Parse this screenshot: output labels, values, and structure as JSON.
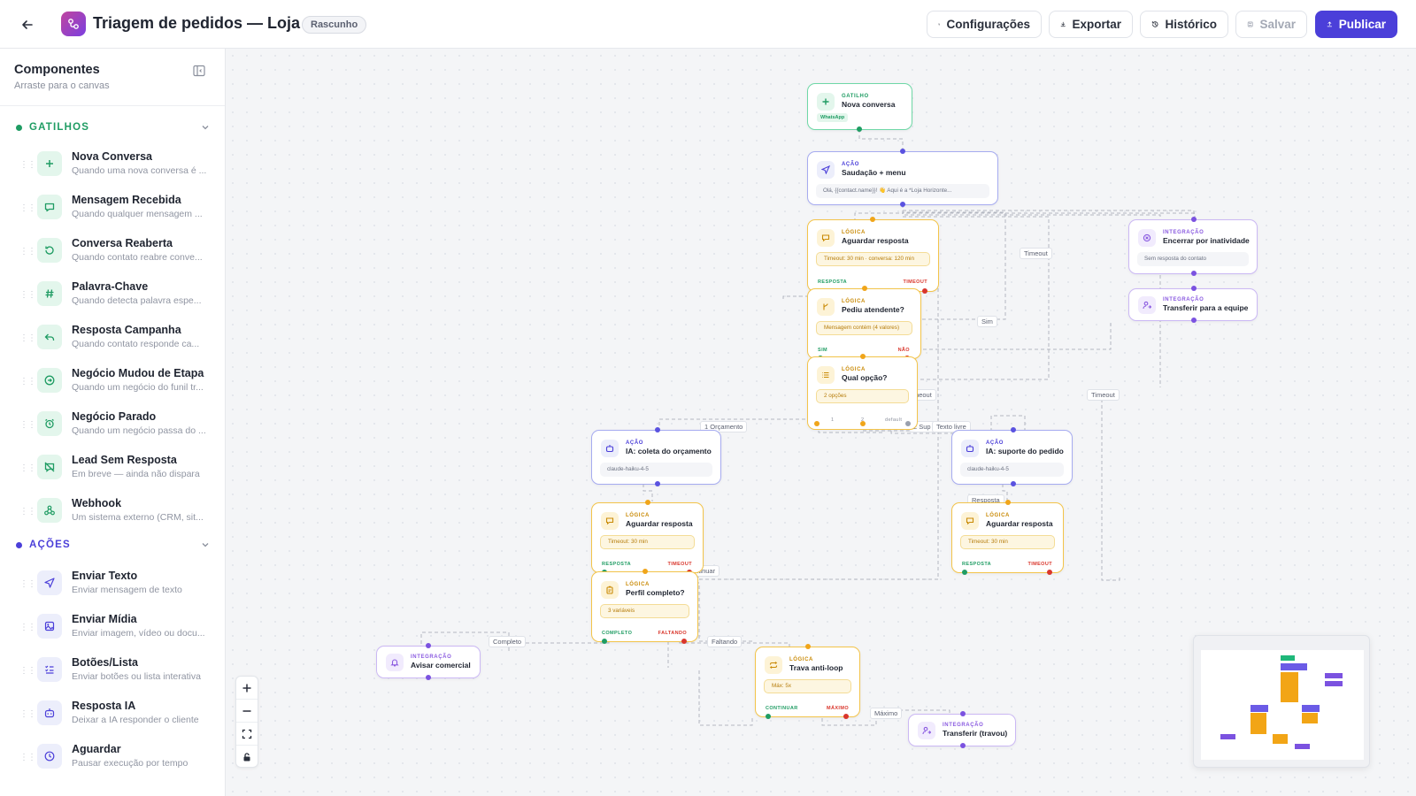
{
  "header": {
    "title": "Triagem de pedidos — Loja ...",
    "status_badge": "Rascunho",
    "buttons": {
      "settings": "Configurações",
      "export": "Exportar",
      "history": "Histórico",
      "save": "Salvar",
      "publish": "Publicar"
    }
  },
  "sidebar": {
    "title": "Componentes",
    "subtitle": "Arraste para o canvas",
    "sections": [
      {
        "label": "GATILHOS",
        "color": "#1f9c63",
        "items": [
          {
            "name": "Nova Conversa",
            "desc": "Quando uma nova conversa é ...",
            "icon": "plus-icon"
          },
          {
            "name": "Mensagem Recebida",
            "desc": "Quando qualquer mensagem ...",
            "icon": "message-icon"
          },
          {
            "name": "Conversa Reaberta",
            "desc": "Quando contato reabre conve...",
            "icon": "refresh-icon"
          },
          {
            "name": "Palavra-Chave",
            "desc": "Quando detecta palavra espe...",
            "icon": "hash-icon"
          },
          {
            "name": "Resposta Campanha",
            "desc": "Quando contato responde ca...",
            "icon": "reply-icon"
          },
          {
            "name": "Negócio Mudou de Etapa",
            "desc": "Quando um negócio do funil tr...",
            "icon": "arrow-circle-icon"
          },
          {
            "name": "Negócio Parado",
            "desc": "Quando um negócio passa do ...",
            "icon": "alarm-icon"
          },
          {
            "name": "Lead Sem Resposta",
            "desc": "Em breve — ainda não dispara",
            "icon": "message-off-icon"
          },
          {
            "name": "Webhook",
            "desc": "Um sistema externo (CRM, sit...",
            "icon": "webhook-icon"
          }
        ]
      },
      {
        "label": "AÇÕES",
        "color": "#4b3fd9",
        "items": [
          {
            "name": "Enviar Texto",
            "desc": "Enviar mensagem de texto",
            "icon": "send-icon"
          },
          {
            "name": "Enviar Mídia",
            "desc": "Enviar imagem, vídeo ou docu...",
            "icon": "image-icon"
          },
          {
            "name": "Botões/Lista",
            "desc": "Enviar botões ou lista interativa",
            "icon": "list-check-icon"
          },
          {
            "name": "Resposta IA",
            "desc": "Deixar a IA responder o cliente",
            "icon": "bot-icon"
          },
          {
            "name": "Aguardar",
            "desc": "Pausar execução por tempo",
            "icon": "clock-icon"
          }
        ]
      }
    ]
  },
  "canvas": {
    "nodes": {
      "trigger": {
        "kind": "GATILHO",
        "title": "Nova conversa",
        "tag": "WhatsApp"
      },
      "greeting": {
        "kind": "AÇÃO",
        "title": "Saudação + menu",
        "detail": "Olá, {{contact.name}}! 👋 Aqui é a *Loja Horizonte..."
      },
      "wait1": {
        "kind": "LÓGICA",
        "title": "Aguardar resposta",
        "detail": "Timeout: 30 min · conversa: 120 min",
        "port_ok": "RESPOSTA",
        "port_bad": "TIMEOUT"
      },
      "askAgent": {
        "kind": "LÓGICA",
        "title": "Pediu atendente?",
        "detail": "Mensagem contém (4 valores)",
        "port_ok": "SIM",
        "port_bad": "NÃO"
      },
      "whichOption": {
        "kind": "LÓGICA",
        "title": "Qual opção?",
        "detail": "2 opções",
        "port_1": "1",
        "port_2": "2",
        "port_default": "default"
      },
      "endInactive": {
        "kind": "INTEGRAÇÃO",
        "title": "Encerrar por inatividade",
        "detail": "Sem resposta do contato"
      },
      "transferTeam": {
        "kind": "INTEGRAÇÃO",
        "title": "Transferir para a equipe"
      },
      "aiQuote": {
        "kind": "AÇÃO",
        "title": "IA: coleta do orçamento",
        "detail": "claude-haiku-4-5"
      },
      "aiSupport": {
        "kind": "AÇÃO",
        "title": "IA: suporte do pedido",
        "detail": "claude-haiku-4-5"
      },
      "wait2": {
        "kind": "LÓGICA",
        "title": "Aguardar resposta",
        "detail": "Timeout: 30 min",
        "port_ok": "RESPOSTA",
        "port_bad": "TIMEOUT"
      },
      "wait3": {
        "kind": "LÓGICA",
        "title": "Aguardar resposta",
        "detail": "Timeout: 30 min",
        "port_ok": "RESPOSTA",
        "port_bad": "TIMEOUT"
      },
      "profile": {
        "kind": "LÓGICA",
        "title": "Perfil completo?",
        "detail": "3 variáveis",
        "port_ok": "COMPLETO",
        "port_bad": "FALTANDO"
      },
      "notifySales": {
        "kind": "INTEGRAÇÃO",
        "title": "Avisar comercial"
      },
      "antiLoop": {
        "kind": "LÓGICA",
        "title": "Trava anti-loop",
        "detail": "Máx: 5x",
        "port_ok": "CONTINUAR",
        "port_bad": "MÁXIMO"
      },
      "transferStuck": {
        "kind": "INTEGRAÇÃO",
        "title": "Transferir (travou)"
      }
    },
    "edge_labels": {
      "timeout_a": "Timeout",
      "sim": "Sim",
      "timeout_b": "Timeout",
      "timeout_c": "Timeout",
      "orcamento": "1 Orçamento",
      "suporte": "2 Sup",
      "texto_livre": "Texto livre",
      "resposta": "Resposta",
      "continuar": "ontinuar",
      "completo": "Completo",
      "faltando": "Faltando",
      "maximo": "Máximo"
    },
    "colors": {
      "gatilho": "#1f9c63",
      "acao": "#4b3fd9",
      "logica": "#f0a51a",
      "integracao": "#8a5ae0"
    }
  }
}
